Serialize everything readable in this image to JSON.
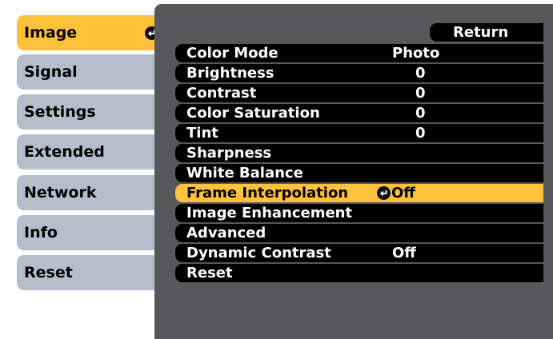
{
  "sidebar": {
    "items": [
      {
        "label": "Image",
        "active": true
      },
      {
        "label": "Signal"
      },
      {
        "label": "Settings"
      },
      {
        "label": "Extended"
      },
      {
        "label": "Network"
      },
      {
        "label": "Info"
      },
      {
        "label": "Reset"
      }
    ]
  },
  "main": {
    "return_label": "Return",
    "rows": [
      {
        "label": "Color Mode",
        "value": "Photo"
      },
      {
        "label": "Brightness",
        "value": "0"
      },
      {
        "label": "Contrast",
        "value": "0"
      },
      {
        "label": "Color Saturation",
        "value": "0"
      },
      {
        "label": "Tint",
        "value": "0"
      },
      {
        "label": "Sharpness",
        "value": ""
      },
      {
        "label": "White Balance",
        "value": ""
      },
      {
        "label": "Frame Interpolation",
        "value": "Off",
        "selected": true
      },
      {
        "label": "Image Enhancement",
        "value": ""
      },
      {
        "label": "Advanced",
        "value": ""
      },
      {
        "label": "Dynamic Contrast",
        "value": "Off"
      },
      {
        "label": "Reset",
        "value": ""
      }
    ]
  },
  "colors": {
    "accent": "#ffc23a",
    "tab_inactive": "#b9bccb",
    "panel": "#58585a",
    "row": "#000000"
  },
  "icons": {
    "enter": "enter-icon"
  }
}
